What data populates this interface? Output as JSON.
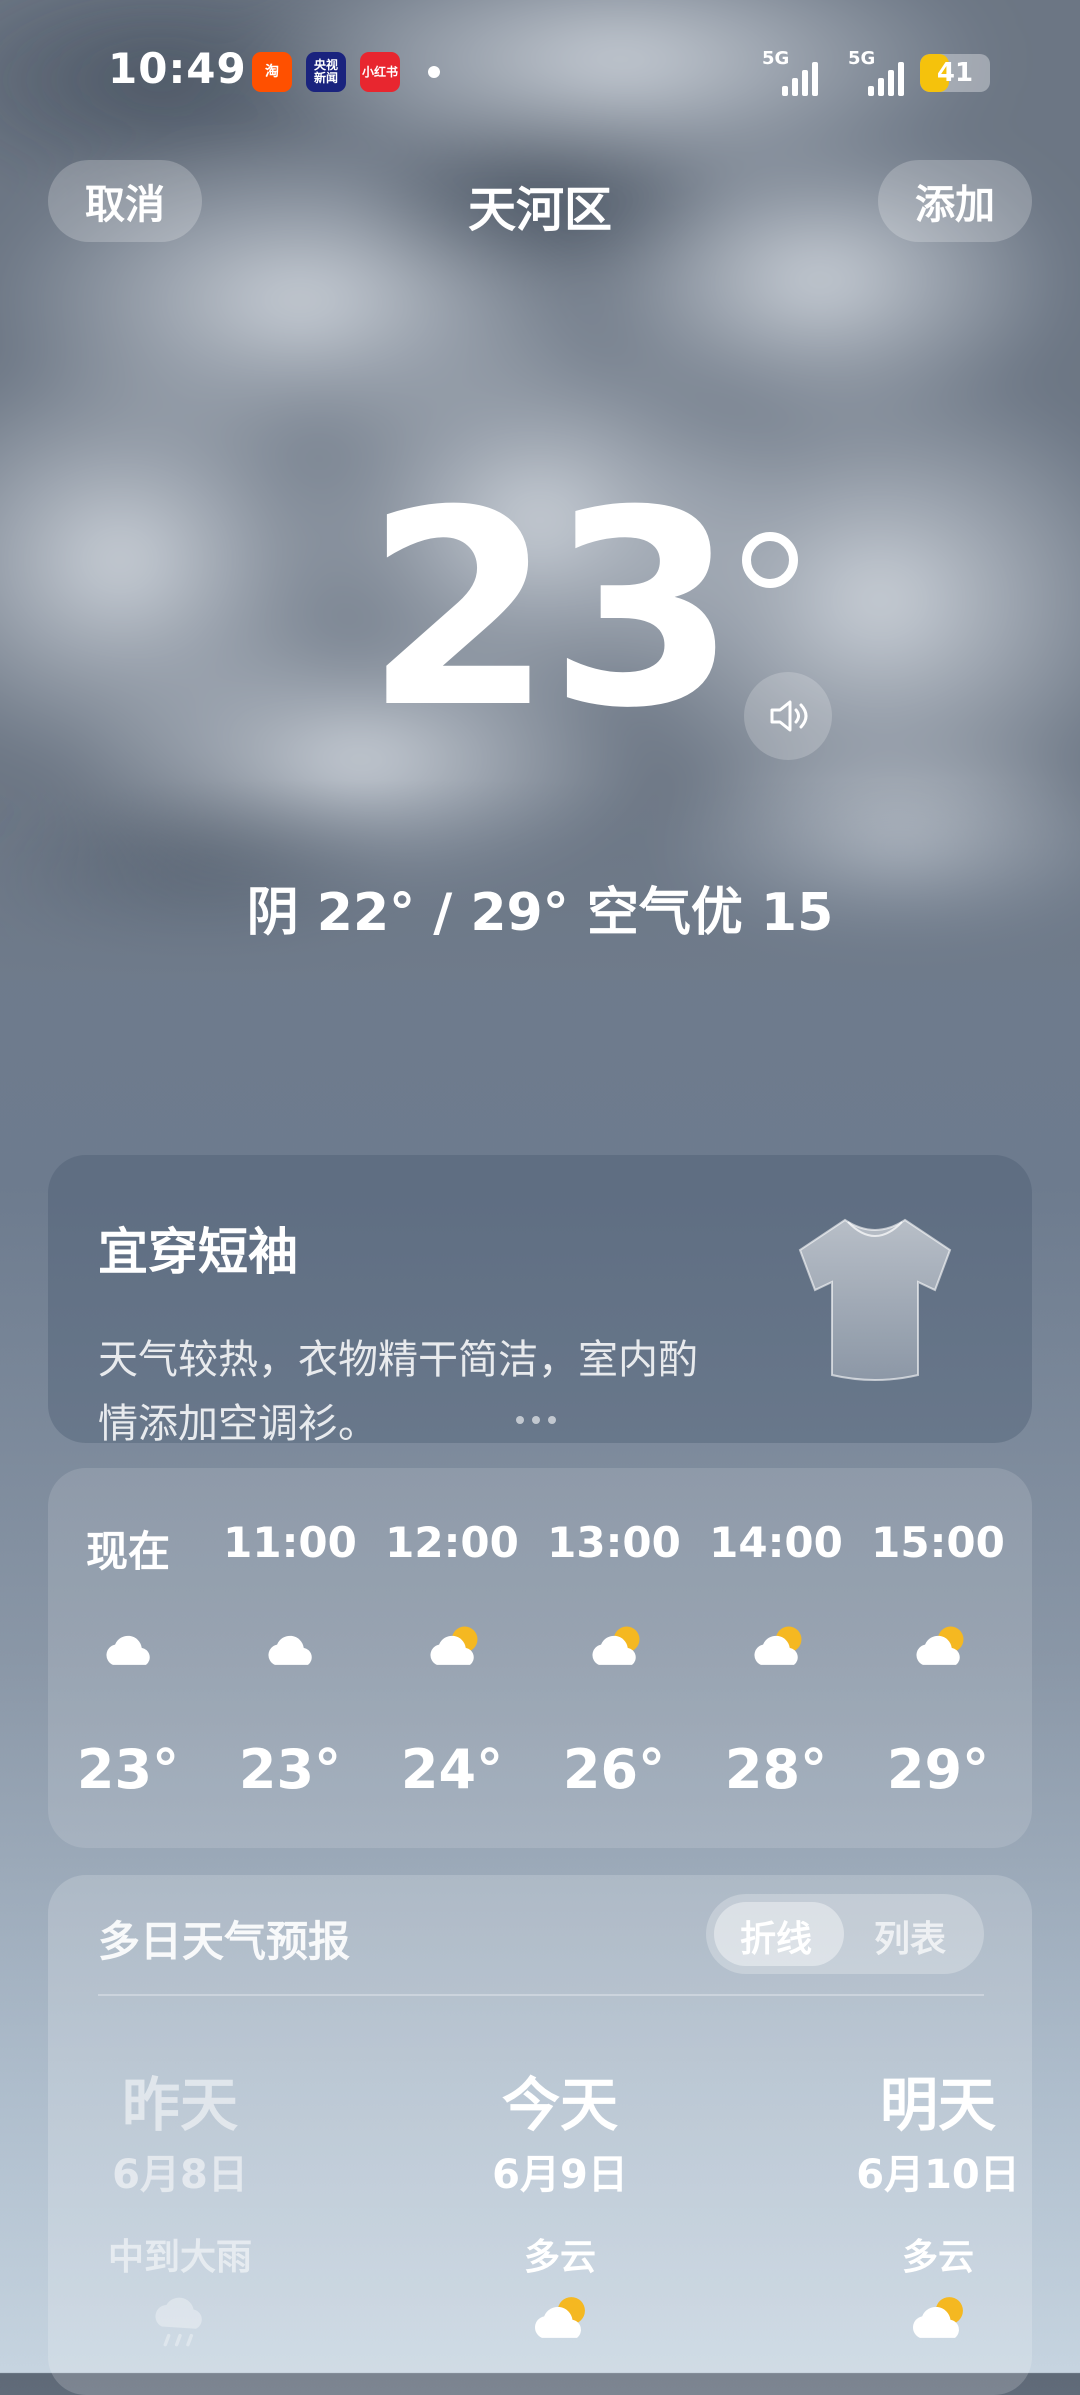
{
  "status_bar": {
    "time": "10:49",
    "apps": [
      {
        "name": "taobao-app-icon",
        "label": "淘",
        "bg": "#ff5000"
      },
      {
        "name": "cctv-news-app-icon",
        "label": "央视\n新闻",
        "bg": "#1a237e"
      },
      {
        "name": "xiaohongshu-app-icon",
        "label": "小红书",
        "bg": "#e8262f"
      }
    ],
    "signal1_label": "5G",
    "signal2_label": "5G",
    "battery": "41",
    "battery_level": 0.41
  },
  "header": {
    "cancel_label": "取消",
    "title": "天河区",
    "add_label": "添加"
  },
  "current": {
    "temperature": "23",
    "summary": "阴  22° / 29°  空气优 15"
  },
  "clothing_card": {
    "title": "宜穿短袖",
    "description": "天气较热，衣物精干简洁，室内酌情添加空调衫。"
  },
  "hourly": [
    {
      "hour": "现在",
      "temp": "23°",
      "icon": "cloudy"
    },
    {
      "hour": "11:00",
      "temp": "23°",
      "icon": "cloudy"
    },
    {
      "hour": "12:00",
      "temp": "24°",
      "icon": "partly-cloudy"
    },
    {
      "hour": "13:00",
      "temp": "26°",
      "icon": "partly-cloudy"
    },
    {
      "hour": "14:00",
      "temp": "28°",
      "icon": "partly-cloudy"
    },
    {
      "hour": "15:00",
      "temp": "29°",
      "icon": "partly-cloudy"
    }
  ],
  "forecast": {
    "title": "多日天气预报",
    "toggle": {
      "line_label": "折线",
      "list_label": "列表",
      "selected": "折线"
    },
    "days": [
      {
        "day": "昨天",
        "date": "6月8日",
        "weather": "中到大雨",
        "icon": "rain"
      },
      {
        "day": "今天",
        "date": "6月9日",
        "weather": "多云",
        "icon": "partly-cloudy"
      },
      {
        "day": "明天",
        "date": "6月10日",
        "weather": "多云",
        "icon": "partly-cloudy"
      }
    ]
  },
  "colors": {
    "sun": "#f5b821",
    "battery": "#f5c20c"
  }
}
